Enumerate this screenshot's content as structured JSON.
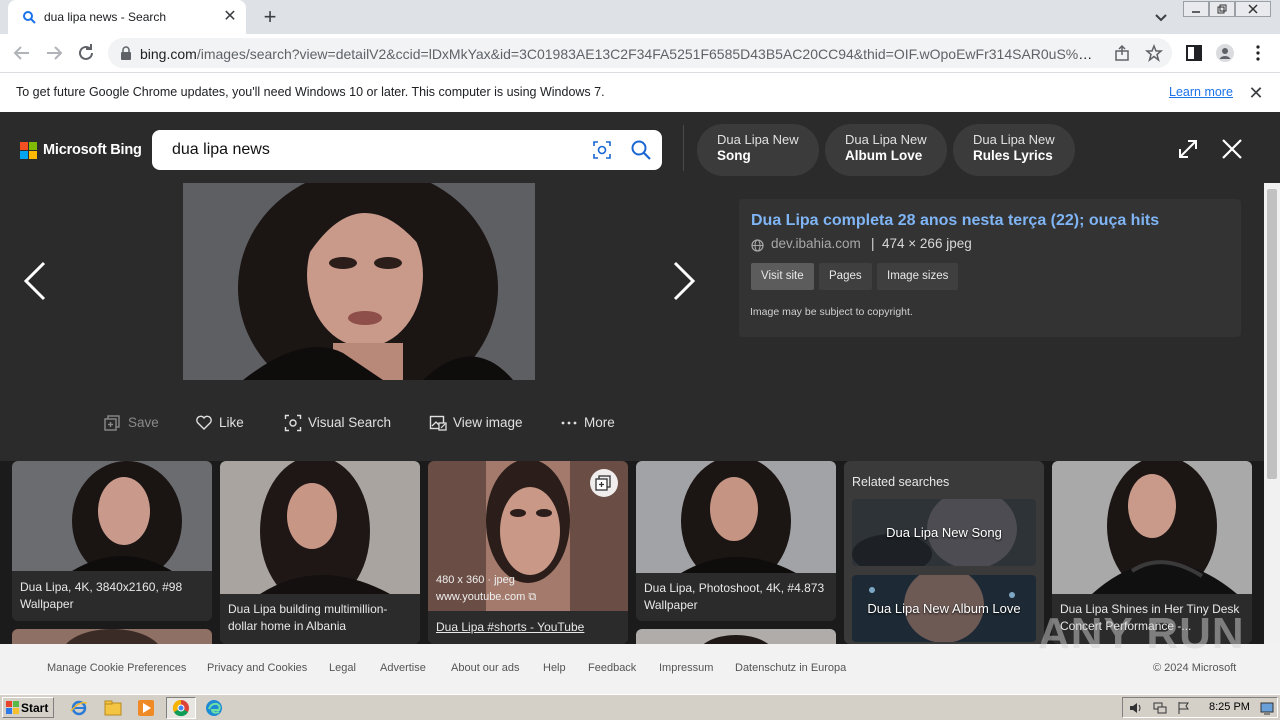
{
  "browser": {
    "tab_title": "dua lipa news - Search",
    "url_host": "bing.com",
    "url_path": "/images/search?view=detailV2&ccid=lDxMkYax&id=3C01983AE13C2F34FA5251F6585D43B5AC20CC94&thid=OIF.wOpoEwFr314SAR0uS%2BJd..."
  },
  "infobar": {
    "message": "To get future Google Chrome updates, you'll need Windows 10 or later. This computer is using Windows 7.",
    "link": "Learn more"
  },
  "bing": {
    "logo_text": "Microsoft Bing",
    "query": "dua lipa news",
    "related_pills": [
      {
        "top": "Dua Lipa New",
        "bottom": "Song"
      },
      {
        "top": "Dua Lipa New",
        "bottom": "Album Love"
      },
      {
        "top": "Dua Lipa New",
        "bottom": "Rules Lyrics"
      }
    ]
  },
  "detail": {
    "title": "Dua Lipa completa 28 anos nesta terça (22); ouça hits",
    "domain": "dev.ibahia.com",
    "dims": "474 × 266 jpeg",
    "buttons": [
      "Visit site",
      "Pages",
      "Image sizes"
    ],
    "copyright": "Image may be subject to copyright.",
    "actions": [
      "Save",
      "Like",
      "Visual Search",
      "View image",
      "More"
    ]
  },
  "results": {
    "card1_title": "Dua Lipa, 4K, 3840x2160, #98 Wallpaper",
    "card2_title": "Dua Lipa building multimillion-dollar home in Albania",
    "card3_meta": "480 x 360 · jpeg",
    "card3_source": "www.youtube.com",
    "card3_link": "Dua Lipa #shorts - YouTube",
    "card4_title": "Dua Lipa, Photoshoot, 4K, #4.873 Wallpaper",
    "related_header": "Related searches",
    "related_items": [
      "Dua Lipa New Song",
      "Dua Lipa New Album Love"
    ],
    "card6_title": "Dua Lipa Shines in Her Tiny Desk Concert Performance -..."
  },
  "footer": {
    "links": [
      "Manage Cookie Preferences",
      "Privacy and Cookies",
      "Legal",
      "Advertise",
      "About our ads",
      "Help",
      "Feedback",
      "Impressum",
      "Datenschutz in Europa"
    ],
    "copyright": "© 2024 Microsoft",
    "watermark": "ANY RUN"
  },
  "taskbar": {
    "start": "Start",
    "clock": "8:25 PM"
  },
  "colors": {
    "bing_dark": "#2b2b2b",
    "link_blue": "#7fb5f5",
    "chrome_blue": "#1a73e8"
  },
  "icons": [
    "search-icon",
    "visual-search-icon",
    "expand-icon",
    "close-icon",
    "chevron-left-icon",
    "chevron-right-icon",
    "globe-icon",
    "save-icon",
    "heart-icon",
    "visual-search-icon",
    "view-image-icon",
    "more-icon",
    "collect-icon",
    "star-icon",
    "share-icon",
    "profile-icon",
    "menu-icon"
  ]
}
